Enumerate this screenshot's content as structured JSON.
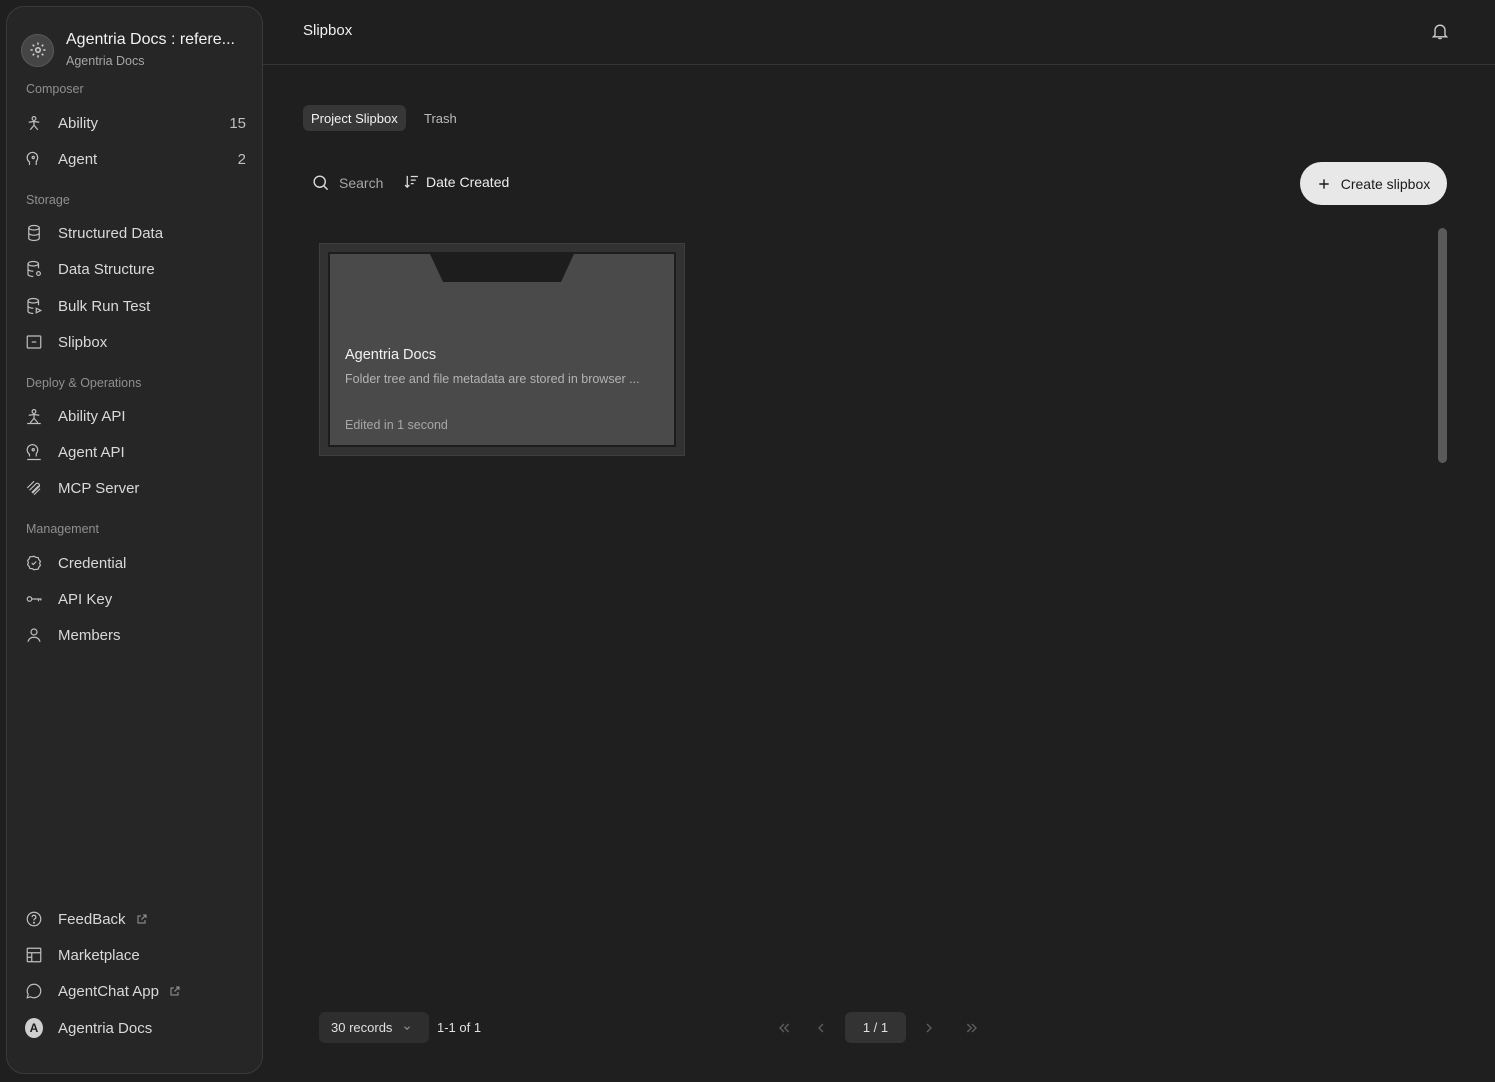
{
  "sidebar": {
    "project": {
      "title": "Agentria Docs : refere...",
      "subtitle": "Agentria Docs"
    },
    "sections": {
      "composer": "Composer",
      "storage": "Storage",
      "deploy": "Deploy & Operations",
      "management": "Management"
    },
    "items": {
      "ability": {
        "label": "Ability",
        "count": "15",
        "icon": "ability-icon"
      },
      "agent": {
        "label": "Agent",
        "count": "2",
        "icon": "agent-icon"
      },
      "structured_data": {
        "label": "Structured Data",
        "icon": "database-icon"
      },
      "data_structure": {
        "label": "Data Structure",
        "icon": "database-settings-icon"
      },
      "bulk_run_test": {
        "label": "Bulk Run Test",
        "icon": "database-play-icon"
      },
      "slipbox": {
        "label": "Slipbox",
        "icon": "slipbox-icon"
      },
      "ability_api": {
        "label": "Ability API",
        "icon": "ability-api-icon"
      },
      "agent_api": {
        "label": "Agent API",
        "icon": "agent-api-icon"
      },
      "mcp_server": {
        "label": "MCP Server",
        "icon": "mcp-icon"
      },
      "credential": {
        "label": "Credential",
        "icon": "credential-icon"
      },
      "api_key": {
        "label": "API Key",
        "icon": "key-icon"
      },
      "members": {
        "label": "Members",
        "icon": "user-icon"
      }
    },
    "footer": {
      "feedback": "FeedBack",
      "marketplace": "Marketplace",
      "agentchat": "AgentChat App",
      "workspace": "Agentria Docs",
      "workspace_initial": "A"
    }
  },
  "header": {
    "title": "Slipbox"
  },
  "tabs": {
    "project": "Project Slipbox",
    "trash": "Trash"
  },
  "toolbar": {
    "search_placeholder": "Search",
    "sort_label": "Date Created",
    "create_label": "Create slipbox"
  },
  "slipboxes": [
    {
      "title": "Agentria Docs",
      "description": "Folder tree and file metadata are stored in browser ...",
      "edited": "Edited in 1 second"
    }
  ],
  "pagination": {
    "per_page": "30 records",
    "range": "1-1 of 1",
    "current": "1 / 1"
  }
}
